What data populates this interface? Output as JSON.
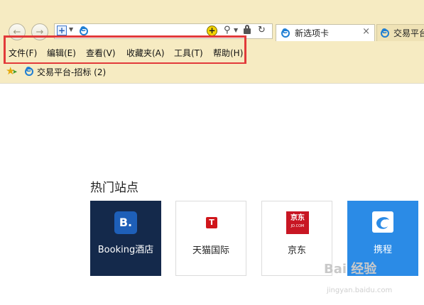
{
  "browser": {
    "tabs": [
      {
        "label": "新选项卡",
        "active": true
      },
      {
        "label": "交易平台",
        "active": false
      }
    ],
    "close_symbol": "×"
  },
  "menu": {
    "items": [
      "文件(F)",
      "编辑(E)",
      "查看(V)",
      "收藏夹(A)",
      "工具(T)",
      "帮助(H)"
    ]
  },
  "favorites": {
    "items": [
      {
        "label": "交易平台-招标 (2)"
      }
    ]
  },
  "content": {
    "section_title": "热门站点",
    "sites": [
      {
        "label": "Booking酒店",
        "icon_text": "B."
      },
      {
        "label": "天猫国际",
        "icon_text": "T"
      },
      {
        "label": "京东",
        "icon_text": "京东",
        "icon_subtext": "JD.COM"
      },
      {
        "label": "携程",
        "icon_text": ""
      }
    ]
  },
  "watermark": {
    "brand": "Bai 经验",
    "url": "jingyan.baidu.com"
  },
  "colors": {
    "chrome_bg": "#f6ebc2",
    "highlight_border": "#e23a3a",
    "booking_bg": "#14294b",
    "ctrip_bg": "#2b8be6",
    "tmall_red": "#d0161b",
    "jd_red": "#c81623",
    "ie_blue": "#1f7ed3"
  }
}
